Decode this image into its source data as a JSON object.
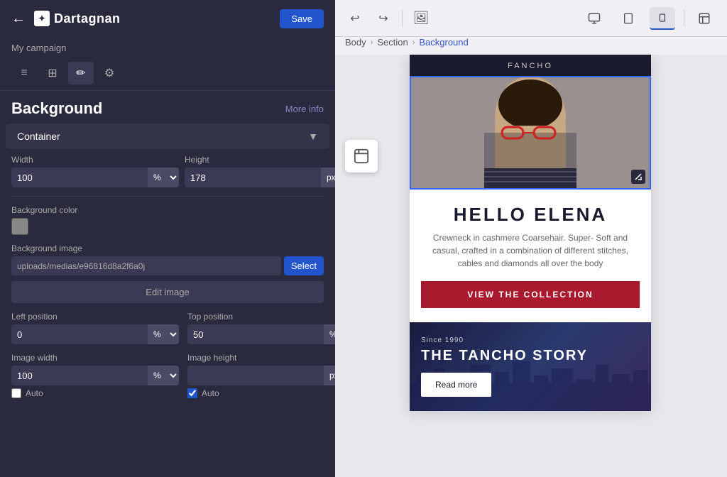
{
  "app": {
    "title": "Dartagnan",
    "back_icon": "←",
    "logo_icon": "✦",
    "save_label": "Save"
  },
  "campaign": {
    "name": "My campaign"
  },
  "toolbar": {
    "undo_icon": "↩",
    "redo_icon": "↪",
    "image_icon": "🖼",
    "desktop_icon": "🖥",
    "tablet_icon": "⬛",
    "mobile_icon": "📱",
    "share_icon": "⊡"
  },
  "breadcrumb": {
    "items": [
      "Body",
      "Section",
      "Background"
    ],
    "active": "Background"
  },
  "panel": {
    "title": "Background",
    "more_info": "More info",
    "tabs": [
      {
        "icon": "≡",
        "name": "layout-tab"
      },
      {
        "icon": "⊞",
        "name": "grid-tab"
      },
      {
        "icon": "✏",
        "name": "style-tab",
        "active": true
      },
      {
        "icon": "≈",
        "name": "settings-tab"
      }
    ],
    "container_label": "Container",
    "width_label": "Width",
    "width_value": "100",
    "width_unit": "%",
    "width_units": [
      "%",
      "px"
    ],
    "height_label": "Height",
    "height_value": "178",
    "height_unit": "px",
    "height_units": [
      "px",
      "%"
    ],
    "bg_color_label": "Background color",
    "bg_image_label": "Background image",
    "image_path": "uploads/medias/e96816d8a2f6a0j",
    "select_label": "Select",
    "edit_image_label": "Edit image",
    "left_pos_label": "Left position",
    "left_pos_value": "0",
    "left_pos_unit": "%",
    "top_pos_label": "Top position",
    "top_pos_value": "50",
    "top_pos_unit": "%",
    "pos_units": [
      "%",
      "px"
    ],
    "img_width_label": "Image width",
    "img_width_value": "100",
    "img_width_unit": "%",
    "img_width_auto": false,
    "img_width_auto_label": "Auto",
    "img_height_label": "Image height",
    "img_height_value": "",
    "img_height_unit": "px",
    "img_height_auto": true,
    "img_height_auto_label": "Auto"
  },
  "preview": {
    "topbar_text": "FANCHO",
    "hero_title": "HELLO ELENA",
    "hero_desc": "Crewneck in cashmere Coarsehair. Super- Soft and casual, crafted in a combination of different stitches, cables and diamonds all over the body",
    "cta_label": "VIEW THE COLLECTION",
    "story_since": "Since 1990",
    "story_title": "THE TANCHO STORY",
    "read_more": "Read more"
  },
  "icons": {
    "back": "←",
    "chevron_right": "›",
    "chevron_down": "▼",
    "check": "✓"
  }
}
